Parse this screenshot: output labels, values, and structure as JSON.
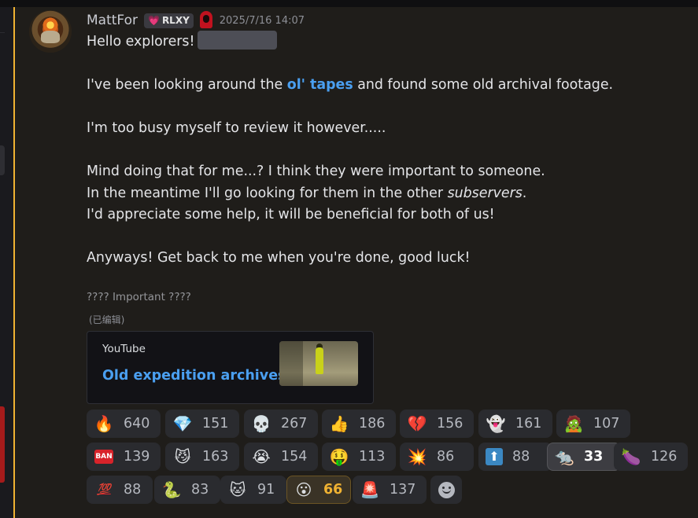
{
  "message": {
    "username": "MattFor",
    "tag": {
      "heart": "💗",
      "label": "RLXY"
    },
    "timestamp": "2025/7/16 14:07",
    "lines": {
      "l1": "Hello explorers!",
      "l2_pre": "I've been looking around the ",
      "l2_link": "ol' tapes",
      "l2_post": " and found some old archival footage.",
      "l3": "I'm too busy myself to review it however.....",
      "l4": "Mind doing that for me...? I think they were important to someone.",
      "l5_pre": "In the meantime I'll go looking for them in the other ",
      "l5_em": "subservers",
      "l5_post": ".",
      "l6": "I'd appreciate some help, it will be beneficial for both of us!",
      "l7": "Anyways! Get back to me when you're done, good luck!"
    },
    "subtext": "???? Important ????",
    "edited": "(已编辑)"
  },
  "embed": {
    "provider": "YouTube",
    "title": "Old expedition archives"
  },
  "reactions": {
    "r1": {
      "emoji": "🔥",
      "count": "640"
    },
    "r2": {
      "emoji": "💎",
      "count": "151"
    },
    "r3": {
      "emoji": "💀",
      "count": "267"
    },
    "r4": {
      "emoji": "👍",
      "count": "186"
    },
    "r5": {
      "emoji": "💔",
      "count": "156"
    },
    "r6": {
      "emoji": "👻",
      "count": "161"
    },
    "r7": {
      "emoji": "🧟",
      "count": "107"
    },
    "r8": {
      "emoji": "BAN",
      "count": "139"
    },
    "r9": {
      "emoji": "😼",
      "count": "163"
    },
    "r10": {
      "emoji": "😭",
      "count": "154"
    },
    "r11": {
      "emoji": "🤑",
      "count": "113"
    },
    "r12": {
      "emoji": "💥",
      "count": "86"
    },
    "r13": {
      "emoji": "⬆",
      "count": "88"
    },
    "r14": {
      "emoji": "🐀",
      "count": "33"
    },
    "r15": {
      "emoji": "🍆",
      "count": "126"
    },
    "r16": {
      "emoji": "💯",
      "count": "88"
    },
    "r17": {
      "emoji": "🐍",
      "count": "83"
    },
    "r18": {
      "emoji": "🐱",
      "count": "91"
    },
    "r19": {
      "emoji": "😮",
      "count": "66"
    },
    "r20": {
      "emoji": "🚨",
      "count": "137"
    }
  },
  "colors": {
    "accent_edge": "#f0b232",
    "link": "#4a9ff0",
    "background": "#1f1d1a"
  }
}
